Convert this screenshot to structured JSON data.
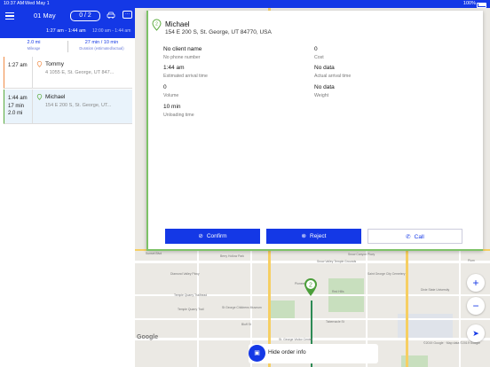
{
  "status_bar": {
    "time": "10:37 AM",
    "date": "Wed May 1",
    "battery": "100%"
  },
  "header": {
    "date": "01 May",
    "counter": "0 / 2",
    "time_range": "1:27 am - 1:44 am",
    "time_range_secondary": "12:00 am - 1:44 am"
  },
  "summary": {
    "mileage_value": "2.0 mi",
    "mileage_label": "Mileage",
    "duration_value": "27 min / 10 min",
    "duration_label": "Duration (estimated/actual)"
  },
  "orders": [
    {
      "time": "1:27 am",
      "name": "Tommy",
      "address": "4 1055 E, St. George, UT 847...",
      "pin_color": "#f08c46"
    },
    {
      "time": "1:44 am",
      "duration": "17 min",
      "distance": "2.0 mi",
      "name": "Michael",
      "address": "154 E 200 S, St. George, UT...",
      "pin_color": "#5aab3c"
    }
  ],
  "detail": {
    "pin_number": "2",
    "name": "Michael",
    "address": "154 E 200 S, St. George, UT 84770, USA",
    "fields": [
      {
        "value": "No client name",
        "label": "No phone number"
      },
      {
        "value": "0",
        "label": "Cost"
      },
      {
        "value": "1:44 am",
        "label": "Estimated arrival time"
      },
      {
        "value": "No data",
        "label": "Actual arrival time"
      },
      {
        "value": "0",
        "label": "Volume"
      },
      {
        "value": "No data",
        "label": "Weight"
      },
      {
        "value": "10 min",
        "label": "Unloading time"
      }
    ],
    "buttons": {
      "confirm": "Confirm",
      "reject": "Reject",
      "call": "Call"
    }
  },
  "map": {
    "labels": [
      "Berry Hollow Park",
      "Snow Canyon Pkwy",
      "Diamond Valley Pkwy",
      "Plum",
      "Red Hills",
      "Pioneer Park",
      "Temple Quarry Trailhead",
      "Temple Quarry Trail",
      "St George Childrens Museum",
      "Dixie State University",
      "Saint George City Cemetery",
      "Snow Valley Temple Grounds",
      "St. George Visitor Center",
      "Sunset Blvd",
      "Tabernacle St",
      "Bluff St",
      "100 S"
    ],
    "google": "Google",
    "copyright": "©2019 Google · Map data ©2019 Google",
    "marker_number": "2",
    "zoom_in": "+",
    "zoom_out": "−",
    "hide_order_label": "Hide order info"
  }
}
